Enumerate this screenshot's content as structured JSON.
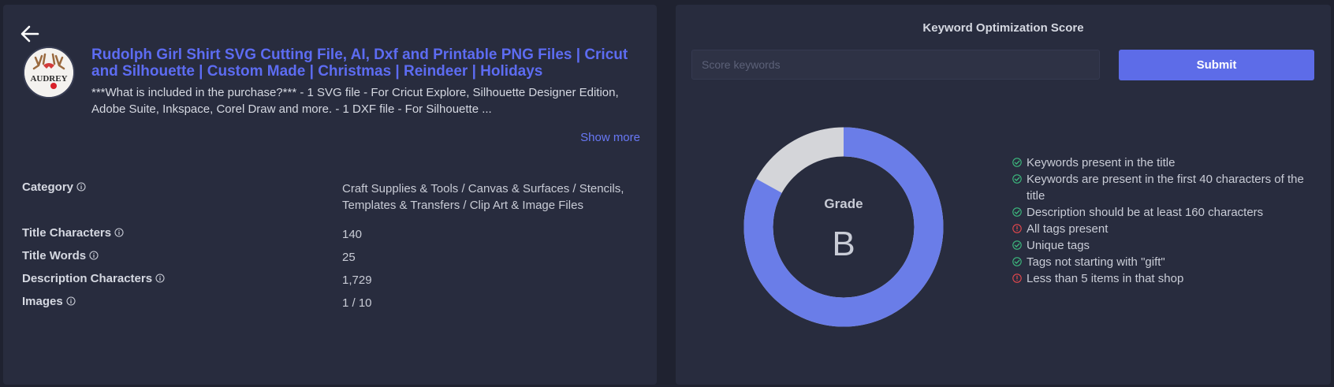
{
  "product": {
    "title": "Rudolph Girl Shirt SVG Cutting File, AI, Dxf and Printable PNG Files | Cricut and Silhouette | Custom Made | Christmas | Reindeer | Holidays",
    "description": "***What is included in the purchase?*** - 1 SVG file - For Cricut Explore, Silhouette Designer Edition, Adobe Suite, Inkspace, Corel Draw and more. - 1 DXF file - For Silhouette ...",
    "show_more": "Show more",
    "thumbnail_text": "AUDREY"
  },
  "details": [
    {
      "label": "Category",
      "value": "Craft Supplies & Tools / Canvas & Surfaces / Stencils, Templates & Transfers / Clip Art & Image Files"
    },
    {
      "label": "Title Characters",
      "value": "140"
    },
    {
      "label": "Title Words",
      "value": "25"
    },
    {
      "label": "Description Characters",
      "value": "1,729"
    },
    {
      "label": "Images",
      "value": "1 / 10"
    }
  ],
  "score": {
    "title": "Keyword Optimization Score",
    "input_placeholder": "Score keywords",
    "input_value": "",
    "submit_label": "Submit",
    "grade_label": "Grade",
    "grade": "B",
    "score_fraction": 0.83,
    "colors": {
      "filled": "#6a7de8",
      "empty": "#d4d5d9",
      "pass": "#3dba7e",
      "fail": "#e5484d"
    }
  },
  "checks": [
    {
      "text": "Keywords present in the title",
      "status": "pass"
    },
    {
      "text": "Keywords are present in the first 40 characters of the title",
      "status": "pass"
    },
    {
      "text": "Description should be at least 160 characters",
      "status": "pass"
    },
    {
      "text": "All tags present",
      "status": "fail"
    },
    {
      "text": "Unique tags",
      "status": "pass"
    },
    {
      "text": "Tags not starting with \"gift\"",
      "status": "pass"
    },
    {
      "text": "Less than 5 items in that shop",
      "status": "fail"
    }
  ]
}
